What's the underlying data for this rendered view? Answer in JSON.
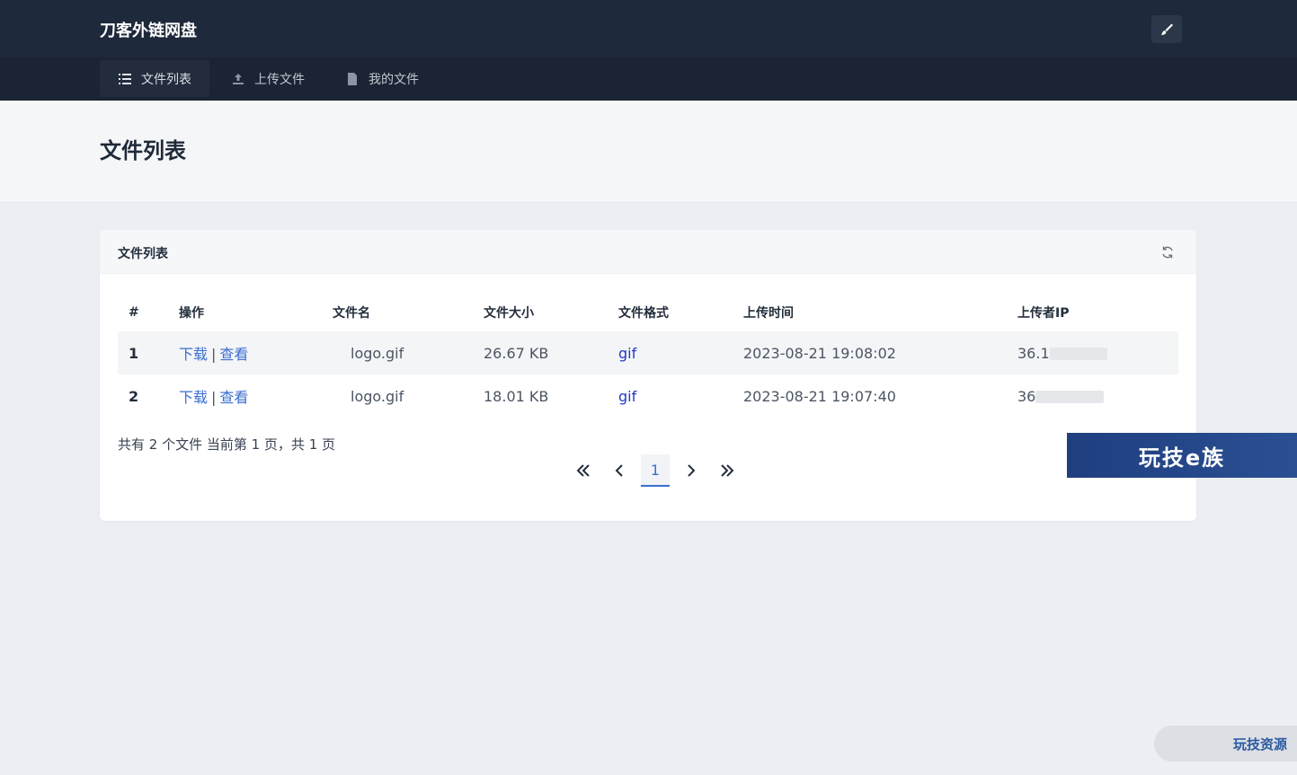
{
  "brand": "刀客外链网盘",
  "nav": [
    {
      "label": "文件列表",
      "icon": "list-icon",
      "active": true
    },
    {
      "label": "上传文件",
      "icon": "upload-icon",
      "active": false
    },
    {
      "label": "我的文件",
      "icon": "file-icon",
      "active": false
    }
  ],
  "page_title": "文件列表",
  "card": {
    "title": "文件列表",
    "columns": [
      "#",
      "操作",
      "文件名",
      "文件大小",
      "文件格式",
      "上传时间",
      "上传者IP"
    ],
    "rows": [
      {
        "num": "1",
        "download": "下载",
        "sep": "|",
        "view": "查看",
        "name": "logo.gif",
        "size": "26.67 KB",
        "format": "gif",
        "time": "2023-08-21 19:08:02",
        "ip": "36.1"
      },
      {
        "num": "2",
        "download": "下载",
        "sep": "|",
        "view": "查看",
        "name": "logo.gif",
        "size": "18.01 KB",
        "format": "gif",
        "time": "2023-08-21 19:07:40",
        "ip": "36"
      }
    ],
    "summary": "共有 2 个文件  当前第 1 页，共 1 页",
    "pagination": {
      "first": "«",
      "prev": "‹",
      "current": "1",
      "next": "›",
      "last": "»"
    }
  },
  "banner": "玩技e族",
  "corner_badge": "玩技资源",
  "colors": {
    "topbar": "#1e293b",
    "navbar": "#1b2434",
    "accent": "#3b6ecf"
  }
}
